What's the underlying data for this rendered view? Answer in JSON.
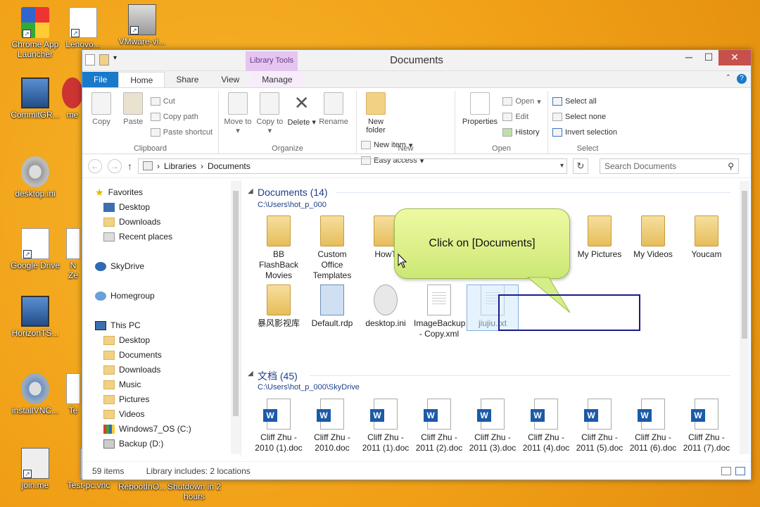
{
  "desktop": {
    "icons": [
      {
        "name": "Chrome App Launcher",
        "kind": "chrome"
      },
      {
        "name": "Lenovo...",
        "kind": "doc"
      },
      {
        "name": "VMware-vi...",
        "kind": "vmware"
      },
      {
        "name": "CommitGR...",
        "kind": "monitor"
      },
      {
        "name": "me",
        "kind": "red"
      },
      {
        "name": "desktop.ini",
        "kind": "gear"
      },
      {
        "name": "Google Drive",
        "kind": "doc"
      },
      {
        "name": "N",
        "kind": "doc"
      },
      {
        "name": "Ze",
        "kind": "doc"
      },
      {
        "name": "HorizonTS...",
        "kind": "monitor"
      },
      {
        "name": "installVNC...",
        "kind": "gear"
      },
      {
        "name": "Te",
        "kind": "doc"
      },
      {
        "name": "join.me",
        "kind": "app"
      },
      {
        "name": "Test-pc.vnc",
        "kind": "doc"
      },
      {
        "name": "RebootInO...",
        "kind": "app"
      },
      {
        "name": "Shutdown in 2 hours",
        "kind": "app"
      }
    ]
  },
  "window": {
    "title": "Documents",
    "context_tab": "Library Tools",
    "tabs": [
      "File",
      "Home",
      "Share",
      "View",
      "Manage"
    ],
    "active_tab": "Home"
  },
  "ribbon": {
    "clipboard": {
      "name": "Clipboard",
      "copy": "Copy",
      "paste": "Paste",
      "cut": "Cut",
      "copy_path": "Copy path",
      "paste_shortcut": "Paste shortcut"
    },
    "organize": {
      "name": "Organize",
      "move_to": "Move to",
      "copy_to": "Copy to",
      "delete": "Delete",
      "rename": "Rename"
    },
    "new": {
      "name": "New",
      "new_folder": "New folder",
      "new_item": "New item",
      "easy_access": "Easy access"
    },
    "open": {
      "name": "Open",
      "properties": "Properties",
      "open": "Open",
      "edit": "Edit",
      "history": "History"
    },
    "select": {
      "name": "Select",
      "select_all": "Select all",
      "select_none": "Select none",
      "invert_selection": "Invert selection"
    }
  },
  "address": {
    "path": [
      "Libraries",
      "Documents"
    ],
    "search_placeholder": "Search Documents"
  },
  "navpane": {
    "favorites": "Favorites",
    "fav_items": [
      "Desktop",
      "Downloads",
      "Recent places"
    ],
    "skydrive": "SkyDrive",
    "homegroup": "Homegroup",
    "thispc": "This PC",
    "pc_items": [
      "Desktop",
      "Documents",
      "Downloads",
      "Music",
      "Pictures",
      "Videos",
      "Windows7_OS (C:)",
      "Backup (D:)"
    ]
  },
  "content": {
    "section1": {
      "title": "Documents (14)",
      "path": "C:\\Users\\hot_p_000"
    },
    "section1_items": [
      {
        "label": "BB FlashBack Movies",
        "type": "folder"
      },
      {
        "label": "Custom Office Templates",
        "type": "folder"
      },
      {
        "label": "HowT",
        "type": "folder"
      },
      {
        "label": "My Pictures",
        "type": "folder"
      },
      {
        "label": "My Videos",
        "type": "folder"
      },
      {
        "label": "Youcam",
        "type": "folder"
      },
      {
        "label": "暴风影视库",
        "type": "folder"
      },
      {
        "label": "Default.rdp",
        "type": "rdp"
      },
      {
        "label": "desktop.ini",
        "type": "gear"
      },
      {
        "label": "ImageBackup - Copy.xml",
        "type": "doc"
      },
      {
        "label": "jiujiu.txt",
        "type": "doc"
      }
    ],
    "section2": {
      "title": "文档 (45)",
      "path": "C:\\Users\\hot_p_000\\SkyDrive"
    },
    "section2_items": [
      "Cliff Zhu - 2010 (1).doc",
      "Cliff Zhu - 2010.doc",
      "Cliff Zhu - 2011 (1).doc",
      "Cliff Zhu - 2011 (2).doc",
      "Cliff Zhu - 2011 (3).doc",
      "Cliff Zhu - 2011 (4).doc",
      "Cliff Zhu - 2011 (5).doc",
      "Cliff Zhu - 2011 (6).doc",
      "Cliff Zhu - 2011 (7).doc"
    ]
  },
  "status": {
    "items": "59 items",
    "library": "Library includes: 2 locations"
  },
  "callout": {
    "text": "Click on [Documents]"
  }
}
